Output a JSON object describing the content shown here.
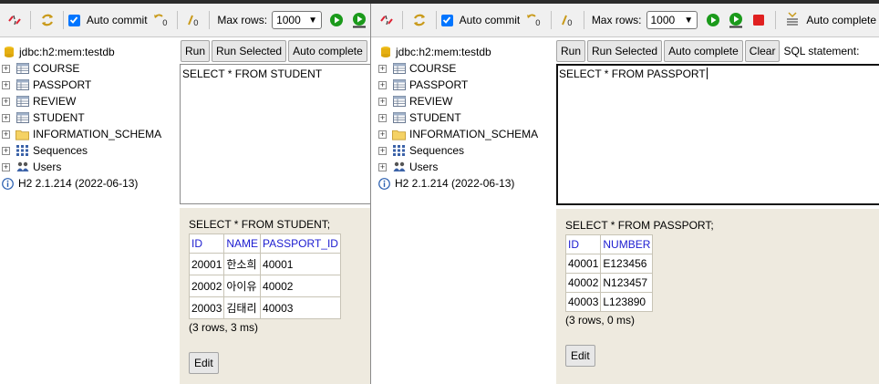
{
  "toolbar": {
    "auto_commit": "Auto commit",
    "max_rows_label": "Max rows:",
    "max_rows_value": "1000",
    "auto_complete": "Auto complete"
  },
  "tree": {
    "connection": "jdbc:h2:mem:testdb",
    "items": [
      "COURSE",
      "PASSPORT",
      "REVIEW",
      "STUDENT",
      "INFORMATION_SCHEMA",
      "Sequences",
      "Users"
    ],
    "version": "H2 2.1.214 (2022-06-13)"
  },
  "left": {
    "buttons": {
      "run": "Run",
      "run_selected": "Run Selected",
      "auto_complete": "Auto complete"
    },
    "editor_text": "SELECT * FROM STUDENT",
    "result": {
      "statement": "SELECT * FROM STUDENT;",
      "columns": [
        "ID",
        "NAME",
        "PASSPORT_ID"
      ],
      "rows": [
        [
          "20001",
          "한소희",
          "40001"
        ],
        [
          "20002",
          "아이유",
          "40002"
        ],
        [
          "20003",
          "김태리",
          "40003"
        ]
      ],
      "summary": "(3 rows, 3 ms)",
      "edit": "Edit"
    }
  },
  "right": {
    "buttons": {
      "run": "Run",
      "run_selected": "Run Selected",
      "auto_complete": "Auto complete",
      "clear": "Clear"
    },
    "sql_statement_label": "SQL statement:",
    "editor_text": "SELECT * FROM PASSPORT",
    "result": {
      "statement": "SELECT * FROM PASSPORT;",
      "columns": [
        "ID",
        "NUMBER"
      ],
      "rows": [
        [
          "40001",
          "E123456"
        ],
        [
          "40002",
          "N123457"
        ],
        [
          "40003",
          "L123890"
        ]
      ],
      "summary": "(3 rows, 0 ms)",
      "edit": "Edit"
    }
  },
  "colors": {
    "header_text": "#1c1cd0",
    "result_bg": "#eeeadf",
    "checkbox": "#0075ff",
    "run_green": "#1b9a1b",
    "stop_red": "#e02020"
  }
}
